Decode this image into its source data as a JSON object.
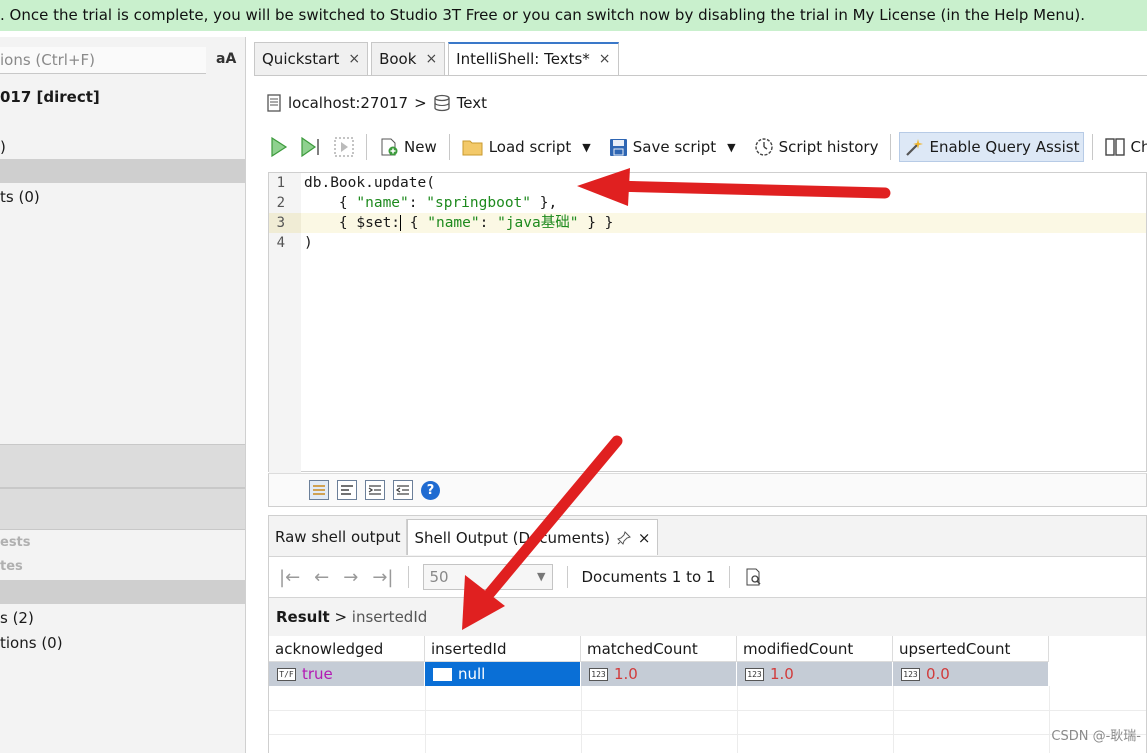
{
  "banner": {
    "text": ". Once the trial is complete, you will be switched to Studio 3T Free or you can switch now by disabling the trial in My License (in the Help Menu)."
  },
  "left_panel": {
    "filter_placeholder": "ions (Ctrl+F)",
    "font_toggle": "aA",
    "connection": "017 [direct]",
    "rows": [
      ")",
      "ts (0)",
      "ests",
      "tes",
      "s (2)",
      "tions (0)"
    ]
  },
  "tabs": [
    {
      "label": "Quickstart"
    },
    {
      "label": "Book"
    },
    {
      "label": "IntelliShell: Texts*"
    }
  ],
  "tab_close_glyph": "×",
  "breadcrumb": {
    "host": "localhost:27017",
    "separator": ">",
    "database": "Text"
  },
  "toolbar": {
    "new_label": "New",
    "load_label": "Load script",
    "save_label": "Save script",
    "history_label": "Script history",
    "assist_label": "Enable Query Assist",
    "change_label": "Chang"
  },
  "editor": {
    "line_numbers": [
      "1",
      "2",
      "3",
      "4"
    ],
    "current_line": 3
  },
  "output": {
    "tab_raw": "Raw shell output",
    "tab_shell": "Shell Output (Documents)",
    "page_size": "50",
    "documents_label": "Documents 1 to 1",
    "result_label": "Result",
    "result_sep": ">",
    "result_path": "insertedId",
    "columns": [
      "acknowledged",
      "insertedId",
      "matchedCount",
      "modifiedCount",
      "upsertedCount"
    ],
    "row": {
      "acknowledged": "true",
      "insertedId": "null",
      "matchedCount": "1.0",
      "modifiedCount": "1.0",
      "upsertedCount": "0.0"
    },
    "type_badges": {
      "bool": "T/F",
      "number": "123"
    }
  },
  "watermark": "CSDN @-耿瑞-",
  "colors": {
    "banner_bg": "#c9f0cd",
    "string_green": "#1e8a1e",
    "bool_purple": "#b318b3",
    "number_red": "#d13b3b",
    "selection_blue": "#0a6fd6",
    "arrow_red": "#e02020"
  },
  "icons": [
    "collection-icon",
    "database-icon",
    "run-icon",
    "run-line-icon",
    "run-selection-icon",
    "new-script-icon",
    "folder-icon",
    "save-icon",
    "history-icon",
    "wand-icon",
    "columns-icon",
    "first-page-icon",
    "prev-page-icon",
    "next-page-icon",
    "last-page-icon",
    "query-view-icon",
    "pin-icon",
    "help-icon"
  ]
}
